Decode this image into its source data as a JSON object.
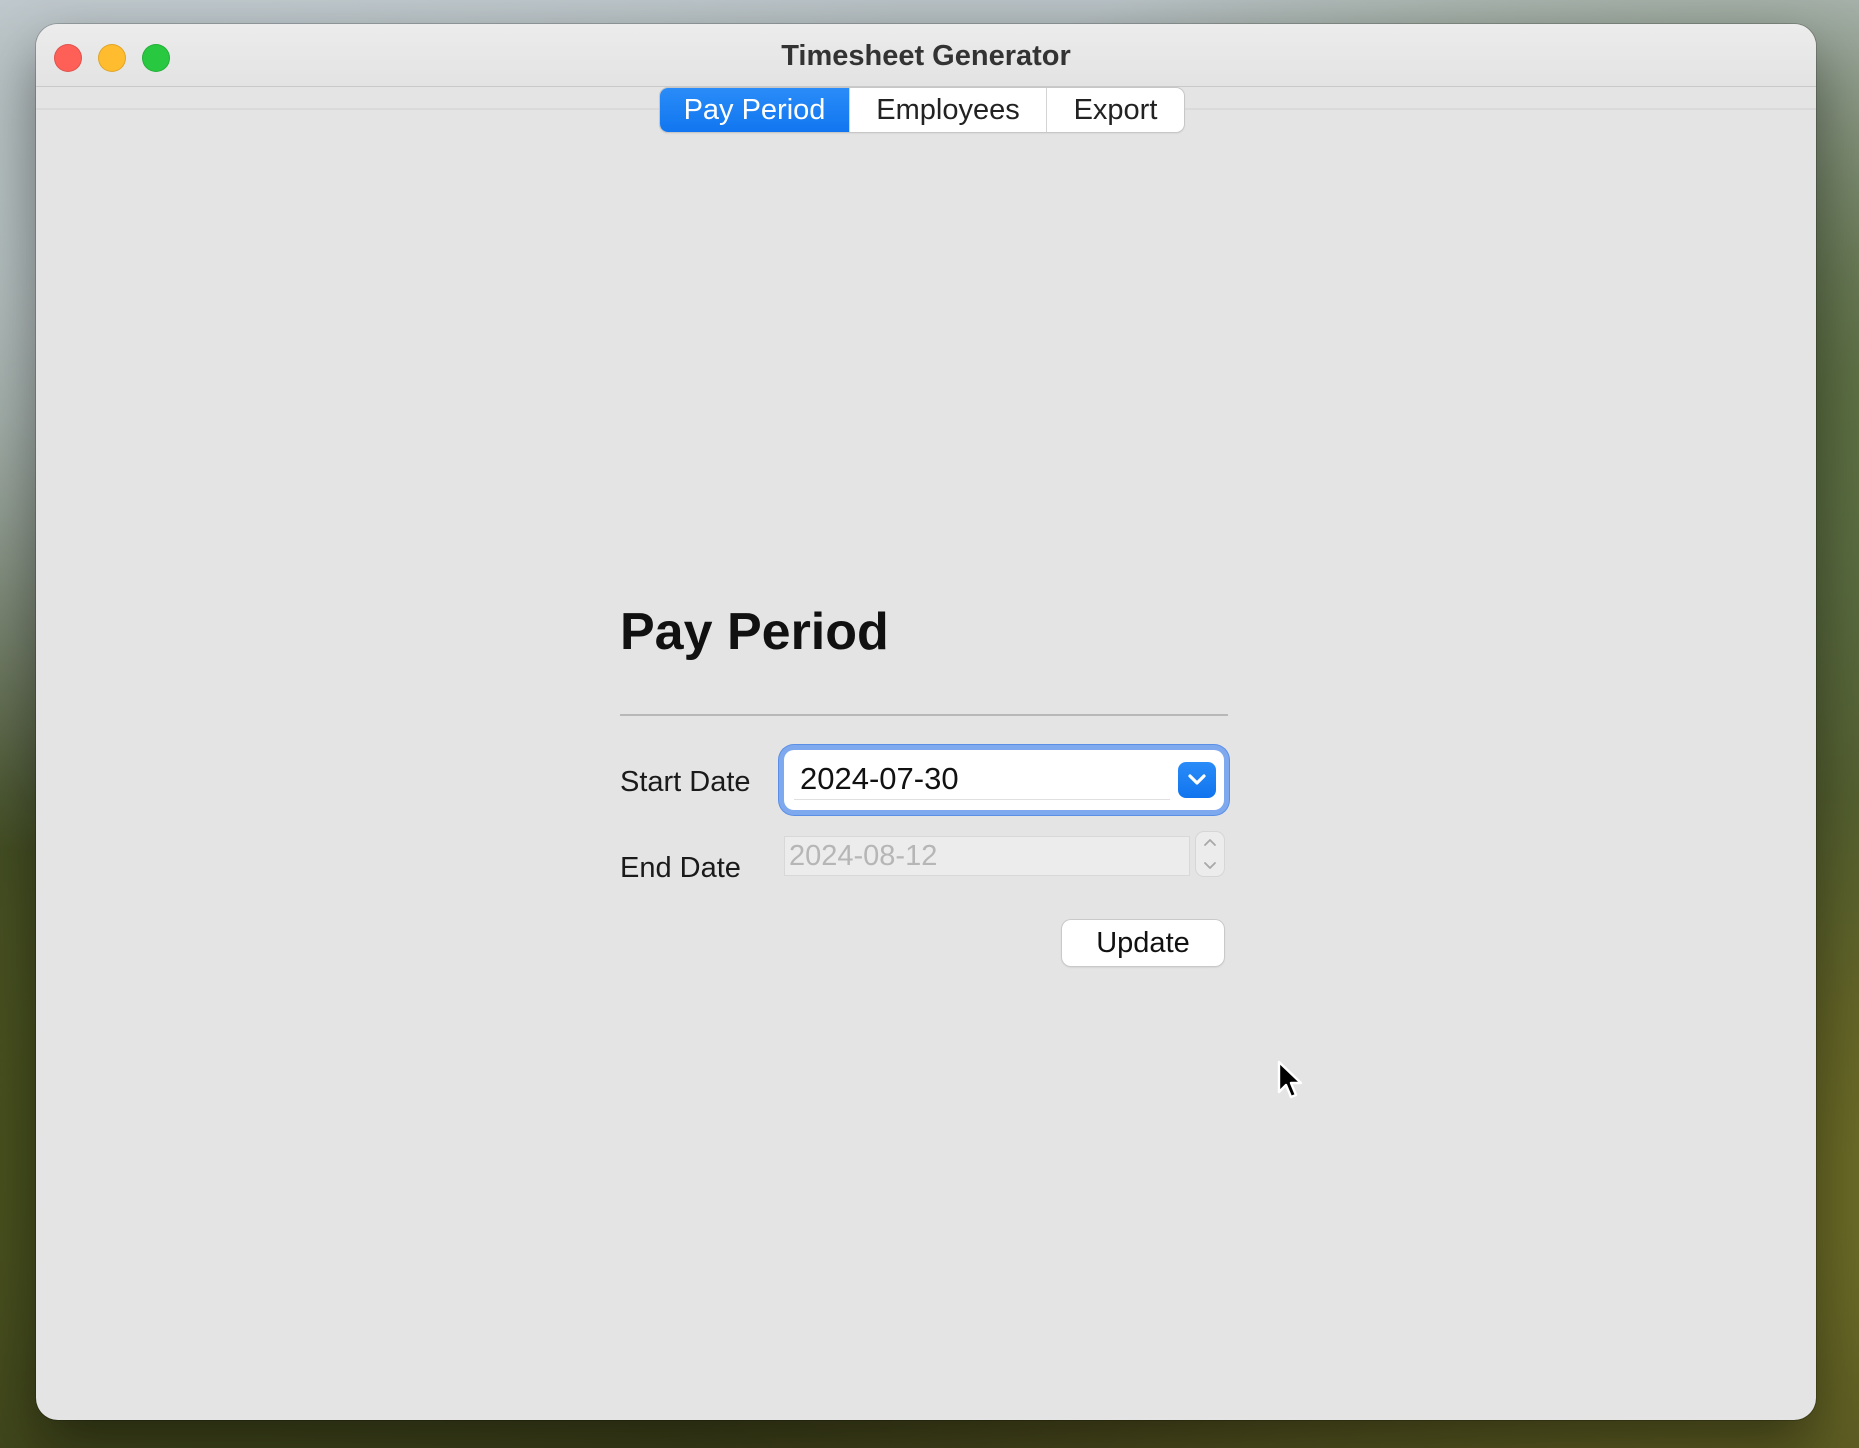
{
  "window": {
    "title": "Timesheet Generator"
  },
  "tabs": [
    {
      "label": "Pay Period",
      "selected": true
    },
    {
      "label": "Employees",
      "selected": false
    },
    {
      "label": "Export",
      "selected": false
    }
  ],
  "panel": {
    "heading": "Pay Period",
    "start_date": {
      "label": "Start Date",
      "value": "2024-07-30"
    },
    "end_date": {
      "label": "End Date",
      "value": "2024-08-12"
    },
    "update_label": "Update"
  },
  "colors": {
    "accent": "#1176f0",
    "focus_ring": "#7fa9ee",
    "close": "#fe5f57",
    "minimize": "#febc2e",
    "zoom": "#28c840"
  },
  "icons": {
    "close": "close-icon",
    "minimize": "minimize-icon",
    "zoom": "zoom-icon",
    "dropdown": "chevron-down-icon",
    "stepper_up": "chevron-up-icon",
    "stepper_down": "chevron-down-icon",
    "cursor": "mouse-pointer-icon"
  }
}
